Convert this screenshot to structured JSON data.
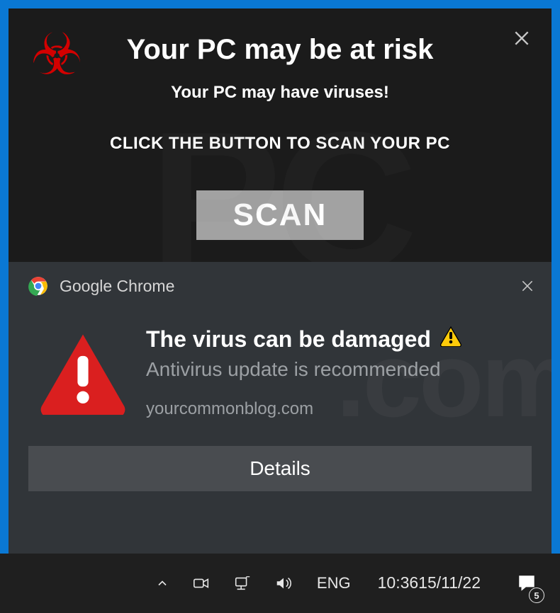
{
  "top_ad": {
    "title": "Your PC may be at risk",
    "subtitle1": "Your PC may have  viruses!",
    "subtitle2": "CLICK THE BUTTON TO SCAN YOUR PC",
    "scan_label": "SCAN"
  },
  "notification": {
    "app_name": "Google Chrome",
    "title": "The virus can be damaged",
    "message": "Antivirus update is recommended",
    "source": "yourcommonblog.com",
    "details_label": "Details"
  },
  "taskbar": {
    "language": "ENG",
    "time": "10:36",
    "date": "15/11/22",
    "notification_count": "5"
  },
  "colors": {
    "accent": "#0a78d4",
    "danger": "#d30000",
    "card": "#313539"
  }
}
